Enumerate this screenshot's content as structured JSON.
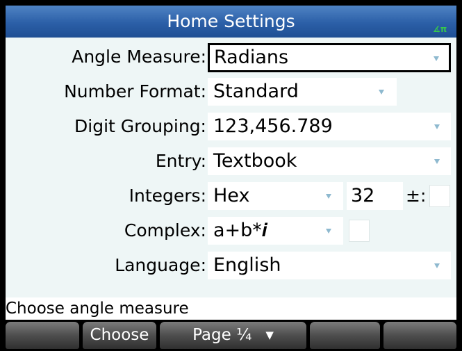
{
  "title": "Home Settings",
  "status_indicator": "∡π",
  "fields": [
    {
      "label": "Angle Measure:",
      "value": "Radians"
    },
    {
      "label": "Number Format:",
      "value": "Standard"
    },
    {
      "label": "Digit Grouping:",
      "value": "123,456.789"
    },
    {
      "label": "Entry:",
      "value": "Textbook"
    },
    {
      "label": "Integers:",
      "value": "Hex",
      "bits": "32",
      "signed_label": "±:",
      "signed_checked": false
    },
    {
      "label": "Complex:",
      "value": "a+b*𝒊",
      "checkbox_checked": false
    },
    {
      "label": "Language:",
      "value": "English"
    }
  ],
  "help_text": "Choose angle measure",
  "menu": {
    "keys": [
      "",
      "Choose",
      "Page ¼",
      "",
      "",
      ""
    ],
    "page_arrow_icon": "▼"
  },
  "colors": {
    "title_bar": "#2b5fa7",
    "form_background": "#eef6f6",
    "dropdown_arrow": "#8eb9cf",
    "indicator": "#37c94a"
  }
}
